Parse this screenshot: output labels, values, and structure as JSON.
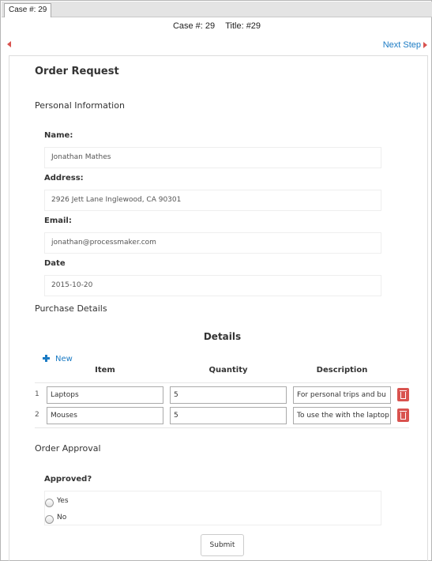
{
  "tab": {
    "label": "Case #: 29"
  },
  "case_bar": {
    "case": "Case #: 29",
    "title": "Title: #29"
  },
  "nav": {
    "next_label": "Next Step"
  },
  "form": {
    "title": "Order Request",
    "personal_section": "Personal Information",
    "fields": {
      "name_label": "Name:",
      "name_value": "Jonathan Mathes",
      "address_label": "Address:",
      "address_value": "2926 Jett Lane Inglewood, CA 90301",
      "email_label": "Email:",
      "email_value": "jonathan@processmaker.com",
      "date_label": "Date",
      "date_value": "2015-10-20"
    },
    "purchase_section": "Purchase Details",
    "grid": {
      "title": "Details",
      "new_label": "New",
      "columns": [
        "Item",
        "Quantity",
        "Description"
      ],
      "rows": [
        {
          "num": "1",
          "item": "Laptops",
          "quantity": "5",
          "description": "For personal trips and bu"
        },
        {
          "num": "2",
          "item": "Mouses",
          "quantity": "5",
          "description": "To use the with the laptop"
        }
      ]
    },
    "approval_section": "Order Approval",
    "approved_label": "Approved?",
    "options": [
      "Yes",
      "No"
    ],
    "submit_label": "Submit"
  },
  "colors": {
    "link": "#1b7bc4",
    "danger": "#d9534f"
  },
  "icons": [
    "prev-arrow-icon",
    "next-arrow-icon",
    "plus-icon",
    "trash-icon"
  ]
}
